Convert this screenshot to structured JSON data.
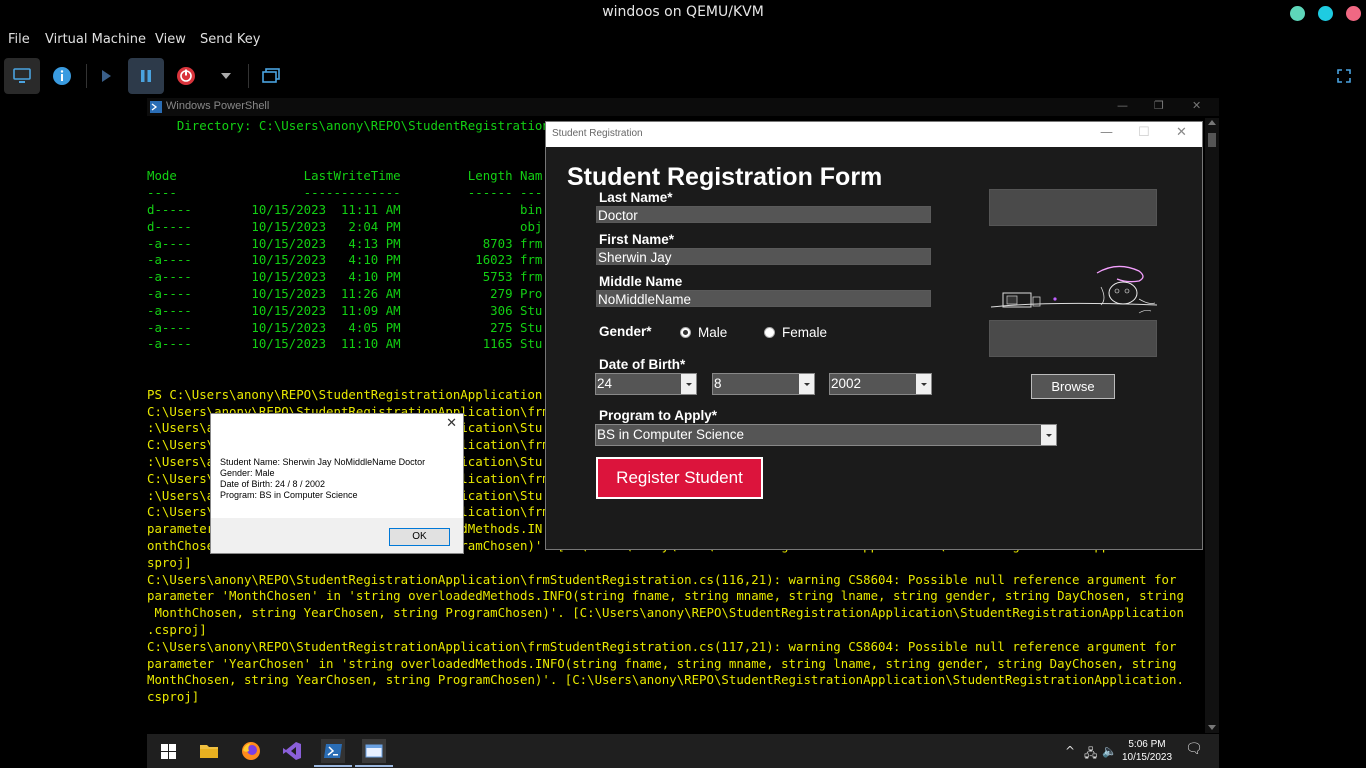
{
  "host": {
    "title": "windoos on QEMU/KVM",
    "menu": [
      "File",
      "Virtual Machine",
      "View",
      "Send Key"
    ],
    "dot_colors": [
      "#5ed6b9",
      "#1ecbe1",
      "#f06883"
    ]
  },
  "powershell": {
    "title": "Windows PowerShell",
    "lines": [
      {
        "t": "    Directory: C:\\Users\\anony\\REPO\\StudentRegistration",
        "c": "green"
      },
      {
        "t": "",
        "c": "green"
      },
      {
        "t": "",
        "c": "green"
      },
      {
        "t": "Mode                 LastWriteTime         Length Nam",
        "c": "green"
      },
      {
        "t": "----                 -------------         ------ ---",
        "c": "green"
      },
      {
        "t": "d-----        10/15/2023  11:11 AM                bin",
        "c": "green"
      },
      {
        "t": "d-----        10/15/2023   2:04 PM                obj",
        "c": "green"
      },
      {
        "t": "-a----        10/15/2023   4:13 PM           8703 frm",
        "c": "green"
      },
      {
        "t": "-a----        10/15/2023   4:10 PM          16023 frm",
        "c": "green"
      },
      {
        "t": "-a----        10/15/2023   4:10 PM           5753 frm",
        "c": "green"
      },
      {
        "t": "-a----        10/15/2023  11:26 AM            279 Pro",
        "c": "green"
      },
      {
        "t": "-a----        10/15/2023  11:09 AM            306 Stu",
        "c": "green"
      },
      {
        "t": "-a----        10/15/2023   4:05 PM            275 Stu",
        "c": "green"
      },
      {
        "t": "-a----        10/15/2023  11:10 AM           1165 Stu",
        "c": "green"
      },
      {
        "t": "",
        "c": "green"
      },
      {
        "t": "",
        "c": "green"
      },
      {
        "t": "PS C:\\Users\\anony\\REPO\\StudentRegistrationApplication",
        "c": "yellow"
      },
      {
        "t": "C:\\Users\\anony\\REPO\\StudentRegistrationApplication\\frm",
        "c": "yellow"
      },
      {
        "t": ":\\Users\\anony\\REPO\\StudentRegistrationApplication\\Stu",
        "c": "yellow"
      },
      {
        "t": "C:\\Users\\anony\\REPO\\StudentRegistrationApplication\\frm",
        "c": "yellow"
      },
      {
        "t": ":\\Users\\anony\\REPO\\StudentRegistrationApplication\\Stu",
        "c": "yellow"
      },
      {
        "t": "C:\\Users\\anony\\REPO\\StudentRegistrationApplication\\frm",
        "c": "yellow"
      },
      {
        "t": ":\\Users\\anony\\REPO\\StudentRegistrationApplication\\Stu",
        "c": "yellow"
      },
      {
        "t": "C:\\Users\\anony\\REPO\\StudentRegistrationApplication\\frm",
        "c": "yellow"
      },
      {
        "t": "parameter 'DayChosen' in 'string overloadedMethods.IN",
        "c": "yellow"
      },
      {
        "t": "onthChosen, string YearChosen, string ProgramChosen)'. [C:\\Users\\anony\\REPO\\StudentRegistrationApplication\\StudentRegistrationApp",
        "c": "yellow"
      },
      {
        "t": "sproj]",
        "c": "yellow"
      },
      {
        "t": "C:\\Users\\anony\\REPO\\StudentRegistrationApplication\\frmStudentRegistration.cs(116,21): warning CS8604: Possible null reference argument for",
        "c": "yellow"
      },
      {
        "t": "parameter 'MonthChosen' in 'string overloadedMethods.INFO(string fname, string mname, string lname, string gender, string DayChosen, string",
        "c": "yellow"
      },
      {
        "t": " MonthChosen, string YearChosen, string ProgramChosen)'. [C:\\Users\\anony\\REPO\\StudentRegistrationApplication\\StudentRegistrationApplication",
        "c": "yellow"
      },
      {
        "t": ".csproj]",
        "c": "yellow"
      },
      {
        "t": "C:\\Users\\anony\\REPO\\StudentRegistrationApplication\\frmStudentRegistration.cs(117,21): warning CS8604: Possible null reference argument for",
        "c": "yellow"
      },
      {
        "t": "parameter 'YearChosen' in 'string overloadedMethods.INFO(string fname, string mname, string lname, string gender, string DayChosen, string",
        "c": "yellow"
      },
      {
        "t": "MonthChosen, string YearChosen, string ProgramChosen)'. [C:\\Users\\anony\\REPO\\StudentRegistrationApplication\\StudentRegistrationApplication.",
        "c": "yellow"
      },
      {
        "t": "csproj]",
        "c": "yellow"
      }
    ]
  },
  "msgbox": {
    "lines": [
      "Student Name: Sherwin Jay NoMiddleName Doctor",
      "Gender: Male",
      "Date of Birth: 24 / 8 / 2002",
      "Program: BS in Computer Science"
    ],
    "ok_label": "OK"
  },
  "form": {
    "window_title": "Student Registration",
    "heading": "Student Registration Form",
    "last_name_label": "Last Name*",
    "last_name_value": "Doctor",
    "first_name_label": "First Name*",
    "first_name_value": "Sherwin Jay",
    "middle_name_label": "Middle Name",
    "middle_name_value": "NoMiddleName",
    "gender_label": "Gender*",
    "gender_male": "Male",
    "gender_female": "Female",
    "gender_selected": "Male",
    "dob_label": "Date of Birth*",
    "dob_day": "24",
    "dob_month": "8",
    "dob_year": "2002",
    "program_label": "Program to Apply*",
    "program_value": "BS in Computer Science",
    "register_label": "Register Student",
    "browse_label": "Browse"
  },
  "taskbar": {
    "time": "5:06 PM",
    "date": "10/15/2023"
  }
}
